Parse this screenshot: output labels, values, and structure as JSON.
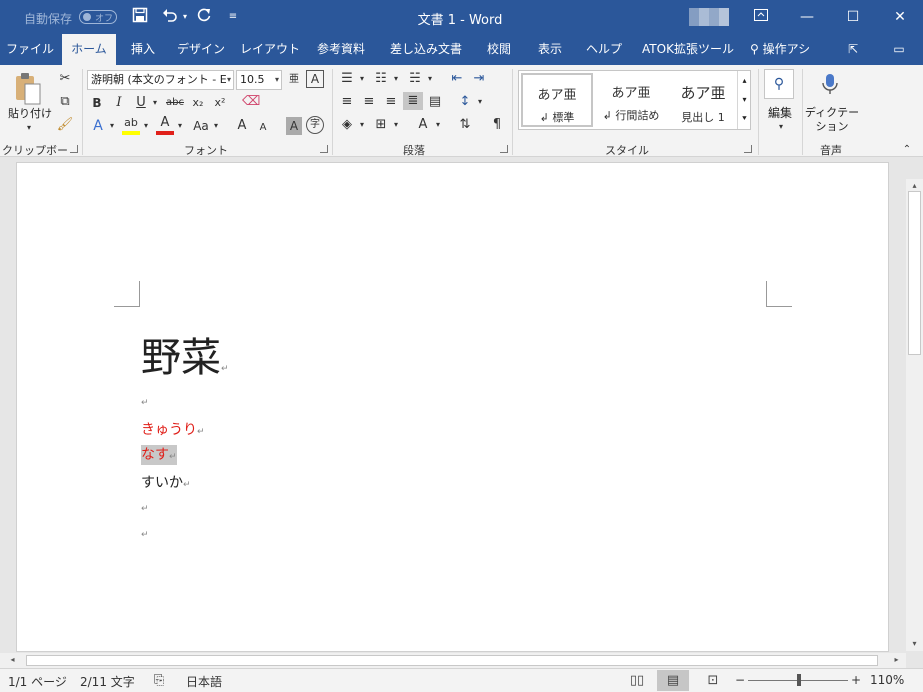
{
  "titlebar": {
    "autosave_label": "自動保存",
    "autosave_state": "オフ",
    "doc_title": "文書 1  -  Word",
    "colors": {
      "bar": "#2b579a"
    }
  },
  "tabs": [
    {
      "label": "ファイル"
    },
    {
      "label": "ホーム"
    },
    {
      "label": "挿入"
    },
    {
      "label": "デザイン"
    },
    {
      "label": "レイアウト"
    },
    {
      "label": "参考資料"
    },
    {
      "label": "差し込み文書"
    },
    {
      "label": "校閲"
    },
    {
      "label": "表示"
    },
    {
      "label": "ヘルプ"
    },
    {
      "label": "ATOK拡張ツール"
    }
  ],
  "active_tab": "ホーム",
  "tell_me": "操作アシ",
  "ribbon": {
    "clipboard": {
      "paste_label": "貼り付け",
      "group_label": "クリップボード"
    },
    "font": {
      "font_name": "游明朝 (本文のフォント - E",
      "font_size": "10.5",
      "group_label": "フォント",
      "bold": "B",
      "italic": "I",
      "underline": "U",
      "strike": "abc",
      "subscript": "x₂",
      "superscript": "x²",
      "grow": "A",
      "shrink": "A",
      "case": "Aa"
    },
    "paragraph": {
      "group_label": "段落"
    },
    "styles": {
      "group_label": "スタイル",
      "items": [
        {
          "preview": "あア亜",
          "name": "↲ 標準"
        },
        {
          "preview": "あア亜",
          "name": "↲ 行間詰め"
        },
        {
          "preview": "あア亜",
          "name": "見出し 1"
        }
      ]
    },
    "editing": {
      "label": "編集"
    },
    "voice": {
      "label": "ディクテー ション",
      "group_label": "音声"
    }
  },
  "document": {
    "heading": "野菜",
    "lines": [
      {
        "text": "",
        "color": "#222222",
        "highlight": false
      },
      {
        "text": "きゅうり",
        "color": "#e0201a",
        "highlight": false
      },
      {
        "text": "なす",
        "color": "#e0201a",
        "highlight": true
      },
      {
        "text": "すいか",
        "color": "#222222",
        "highlight": false
      },
      {
        "text": "",
        "color": "#222222",
        "highlight": false
      },
      {
        "text": "",
        "color": "#222222",
        "highlight": false
      }
    ],
    "paragraph_mark": "↵"
  },
  "status": {
    "page": "1/1 ページ",
    "words": "2/11 文字",
    "language": "日本語",
    "zoom_value": "110%",
    "zoom_out": "−",
    "zoom_in": "+"
  }
}
